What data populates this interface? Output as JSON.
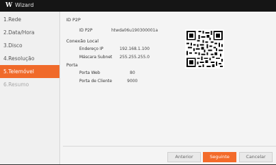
{
  "titlebar": {
    "logo": "W",
    "title": "Wizard"
  },
  "sidebar": {
    "items": [
      {
        "label": "1.Rede"
      },
      {
        "label": "2.Data/Hora"
      },
      {
        "label": "3.Disco"
      },
      {
        "label": "4.Resolução"
      },
      {
        "label": "5.Telemóvel"
      },
      {
        "label": "6.Resumo"
      }
    ]
  },
  "main": {
    "id_p2p": {
      "section": "ID P2P",
      "label": "ID P2P",
      "value": "htwda06u190300001a"
    },
    "local": {
      "section": "Conexão Local",
      "ip_label": "Endereço IP",
      "ip_value": "192.168.1.100",
      "mask_label": "Máscara Subnet",
      "mask_value": "255.255.255.0"
    },
    "ports": {
      "section": "Porta",
      "web_label": "Porta Web",
      "web_value": "80",
      "client_label": "Porta de Cliente",
      "client_value": "9000"
    }
  },
  "buttons": {
    "previous": "Anterior",
    "next": "Seguinte",
    "cancel": "Cancelar"
  },
  "colors": {
    "accent": "#f36b2a",
    "titlebar": "#151515"
  }
}
